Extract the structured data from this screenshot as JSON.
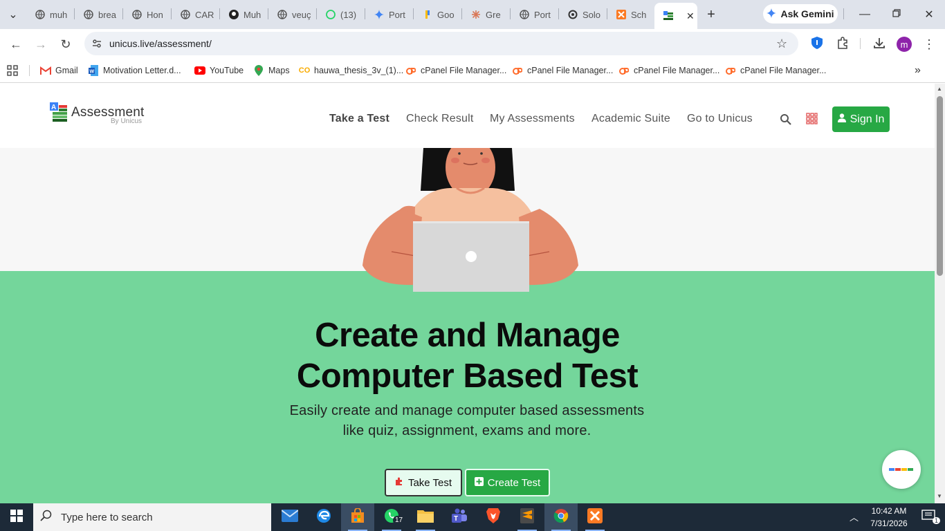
{
  "browser": {
    "tabs": [
      {
        "label": "muh",
        "icon": "globe-icon"
      },
      {
        "label": "brea",
        "icon": "globe-icon"
      },
      {
        "label": "Hon",
        "icon": "globe-icon"
      },
      {
        "label": "CAR",
        "icon": "globe-icon"
      },
      {
        "label": "Muh",
        "icon": "github-icon"
      },
      {
        "label": "veuç",
        "icon": "globe-icon"
      },
      {
        "label": "(13)",
        "icon": "whatsapp-icon"
      },
      {
        "label": "Port",
        "icon": "gemini-icon"
      },
      {
        "label": "Goo",
        "icon": "google-icon"
      },
      {
        "label": "Gre",
        "icon": "claude-icon"
      },
      {
        "label": "Port",
        "icon": "globe-icon"
      },
      {
        "label": "Solo",
        "icon": "openai-icon"
      },
      {
        "label": "Sch",
        "icon": "xampp-icon"
      }
    ],
    "active_tab_icon": "assessment-logo-icon",
    "ask_gemini_label": "Ask Gemini",
    "url": "unicus.live/assessment/",
    "profile_initial": "m"
  },
  "bookmarks": [
    {
      "label": "Gmail",
      "icon": "gmail-icon"
    },
    {
      "label": "Motivation Letter.d...",
      "icon": "word-doc-icon"
    },
    {
      "label": "YouTube",
      "icon": "youtube-icon"
    },
    {
      "label": "Maps",
      "icon": "maps-pin-icon"
    },
    {
      "label": "hauwa_thesis_3v_(1)...",
      "icon": "co-icon"
    },
    {
      "label": "cPanel File Manager...",
      "icon": "cpanel-icon"
    },
    {
      "label": "cPanel File Manager...",
      "icon": "cpanel-icon"
    },
    {
      "label": "cPanel File Manager...",
      "icon": "cpanel-icon"
    },
    {
      "label": "cPanel File Manager...",
      "icon": "cpanel-icon"
    }
  ],
  "site": {
    "logo_title": "Assessment",
    "logo_subtitle": "By Unicus",
    "nav": [
      "Take a Test",
      "Check Result",
      "My Assessments",
      "Academic Suite",
      "Go to Unicus"
    ],
    "signin_label": "Sign In",
    "headline_line1": "Create and Manage",
    "headline_line2": "Computer Based Test",
    "subtitle_line1": "Easily create and manage computer based assessments",
    "subtitle_line2": "like quiz, assignment, exams and more.",
    "take_test_label": "Take Test",
    "create_test_label": "Create Test"
  },
  "taskbar": {
    "search_placeholder": "Type here to search",
    "whatsapp_badge": "17",
    "time": "10:42 AM",
    "date": "7/31/2026",
    "notification_count": "1"
  },
  "colors": {
    "brand_green": "#27a844",
    "hero_green": "#74d69b"
  }
}
